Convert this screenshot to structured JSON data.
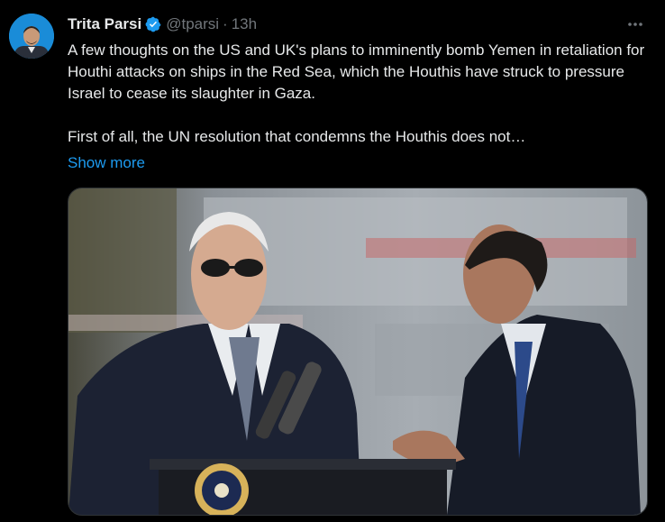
{
  "author": {
    "name": "Trita Parsi",
    "handle": "@tparsi",
    "separator": "·",
    "time": "13h",
    "verified_icon": "verified-badge-icon",
    "avatar_icon": "profile-avatar"
  },
  "tweet": {
    "paragraph1": "A few thoughts on the US and UK's plans to imminently bomb Yemen in retaliation for Houthi attacks on ships in the Red Sea, which the Houthis have struck to pressure Israel to cease its slaughter in Gaza.",
    "paragraph2": "First of all, the UN resolution that condemns the Houthis does not…",
    "show_more": "Show more"
  },
  "actions": {
    "more_icon": "more-options-icon"
  },
  "media": {
    "type": "photo",
    "description_icon": "tweet-photo"
  },
  "colors": {
    "background": "#000000",
    "text": "#e7e9ea",
    "muted": "#71767b",
    "accent": "#1d9bf0"
  }
}
